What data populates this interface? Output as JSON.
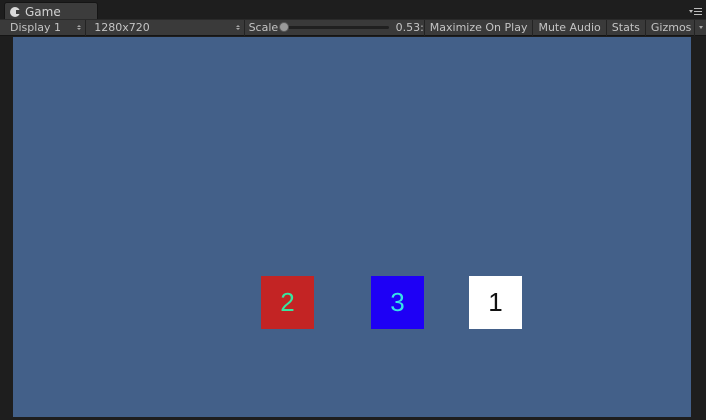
{
  "tab": {
    "title": "Game",
    "icon": "pacman-icon"
  },
  "toolbar": {
    "display": "Display 1",
    "resolution": "1280x720",
    "scale_label": "Scale",
    "scale_value": "0.53:",
    "scale_fraction": 0.0,
    "maximize_label": "Maximize On Play",
    "mute_label": "Mute Audio",
    "stats_label": "Stats",
    "gizmos_label": "Gizmos"
  },
  "viewport": {
    "background": "#436089",
    "squares": [
      {
        "label": "2",
        "color": "#c32424",
        "text_color": "#37e6a0"
      },
      {
        "label": "3",
        "color": "#1e00f5",
        "text_color": "#36e2e6"
      },
      {
        "label": "1",
        "color": "#ffffff",
        "text_color": "#111111"
      }
    ]
  }
}
